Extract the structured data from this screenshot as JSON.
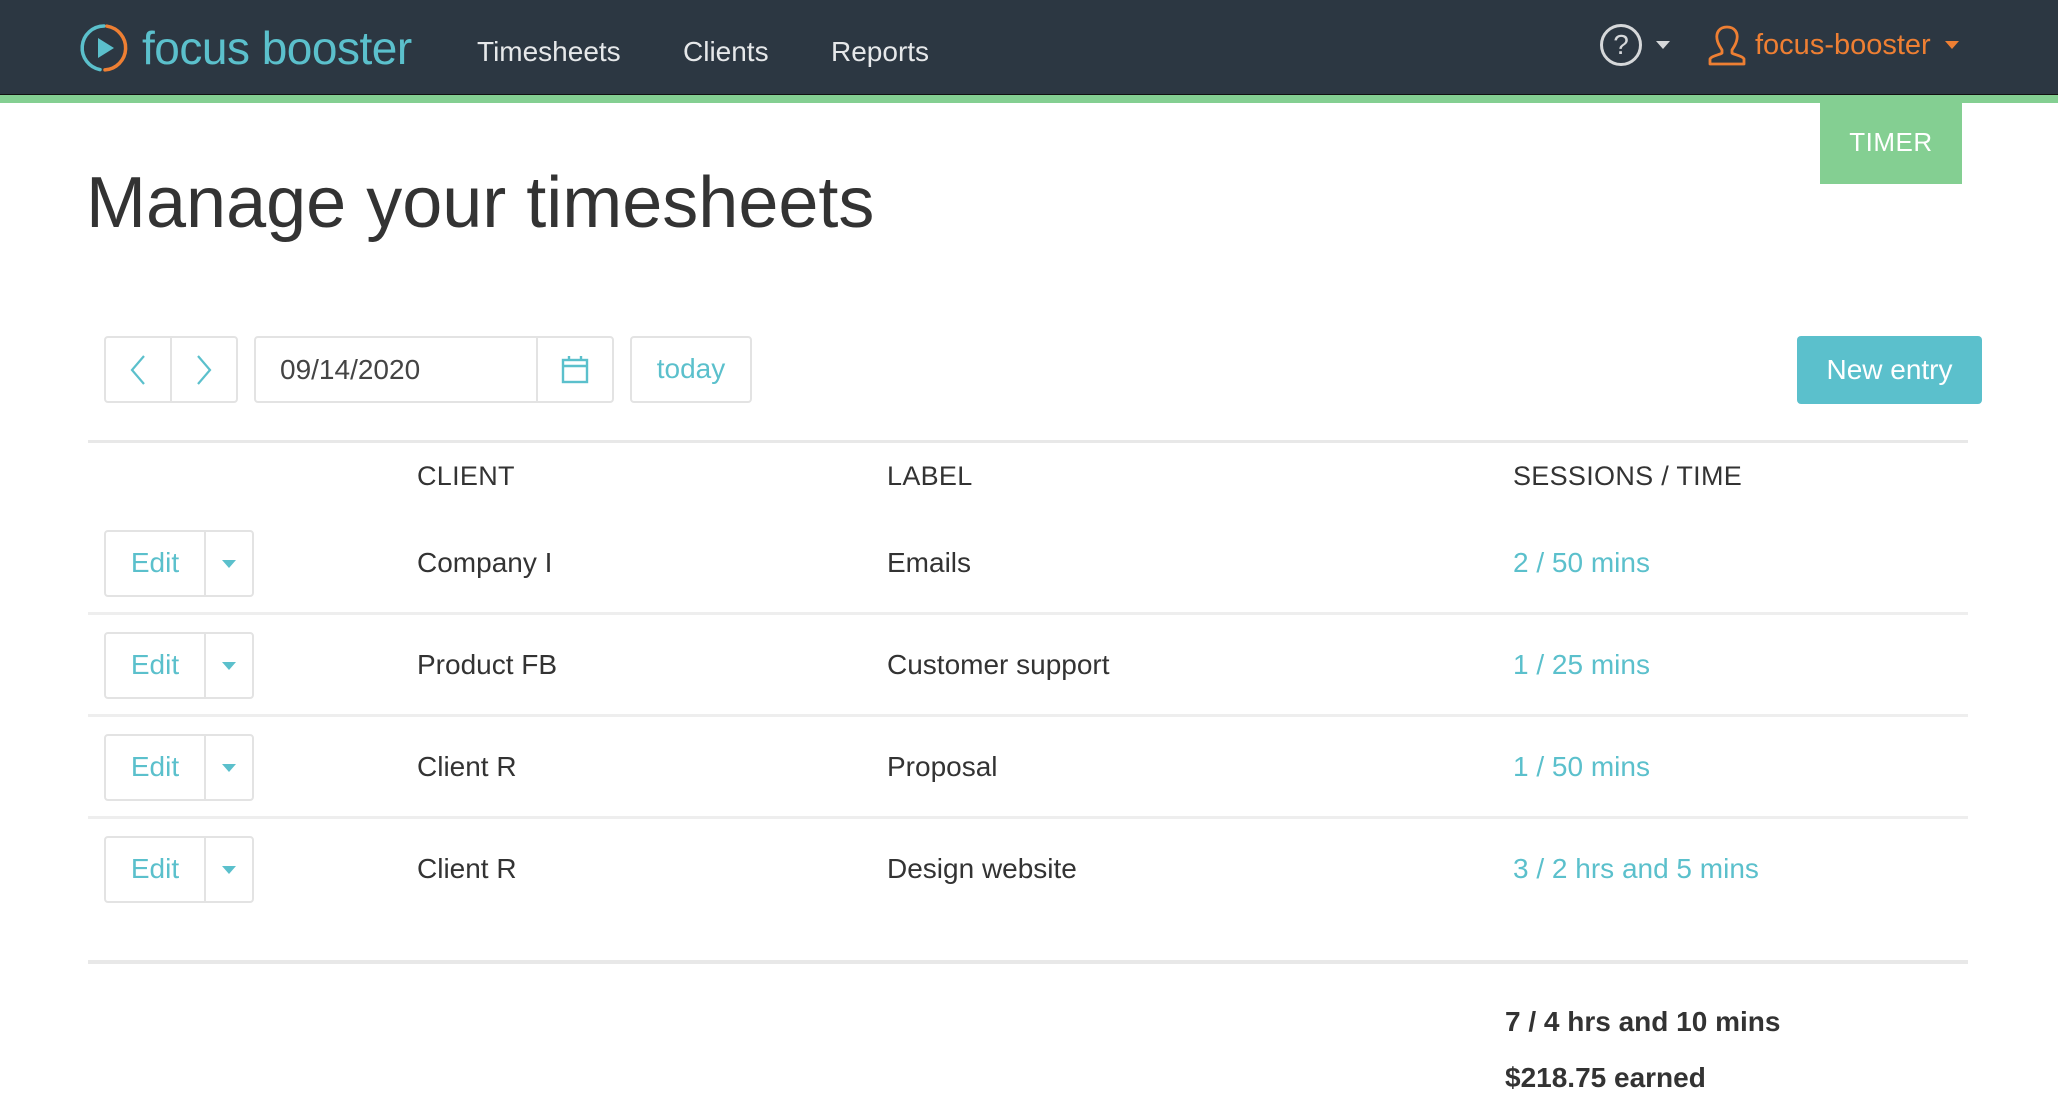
{
  "header": {
    "brand": "focus booster",
    "logo_icon": "play-circle-icon",
    "nav": [
      {
        "label": "Timesheets"
      },
      {
        "label": "Clients"
      },
      {
        "label": "Reports"
      }
    ],
    "help_icon": "question-circle-icon",
    "help_symbol": "?",
    "user_icon": "user-icon",
    "username": "focus-booster",
    "colors": {
      "bar": "#2c3742",
      "strip": "#84cf92",
      "brand": "#5bc0cc",
      "user": "#ee7f33"
    }
  },
  "timer_tab": {
    "label": "TIMER"
  },
  "page": {
    "title": "Manage your timesheets"
  },
  "toolbar": {
    "prev_icon": "chevron-left-icon",
    "next_icon": "chevron-right-icon",
    "date_value": "09/14/2020",
    "calendar_icon": "calendar-icon",
    "today_label": "today",
    "new_entry_label": "New entry",
    "accent": "#5bc0cc"
  },
  "table": {
    "columns": [
      {
        "label": "CLIENT"
      },
      {
        "label": "LABEL"
      },
      {
        "label": "SESSIONS / TIME"
      }
    ],
    "rows": [
      {
        "edit_label": "Edit",
        "client": "Company I",
        "label": "Emails",
        "sessions": "2 / 50 mins"
      },
      {
        "edit_label": "Edit",
        "client": "Product FB",
        "label": "Customer support",
        "sessions": "1 / 25 mins"
      },
      {
        "edit_label": "Edit",
        "client": "Client R",
        "label": "Proposal",
        "sessions": "1 / 50 mins"
      },
      {
        "edit_label": "Edit",
        "client": "Client R",
        "label": "Design website",
        "sessions": "3 / 2 hrs and 5 mins"
      }
    ]
  },
  "totals": {
    "time": "7 / 4 hrs and 10 mins",
    "earned": "$218.75 earned"
  }
}
